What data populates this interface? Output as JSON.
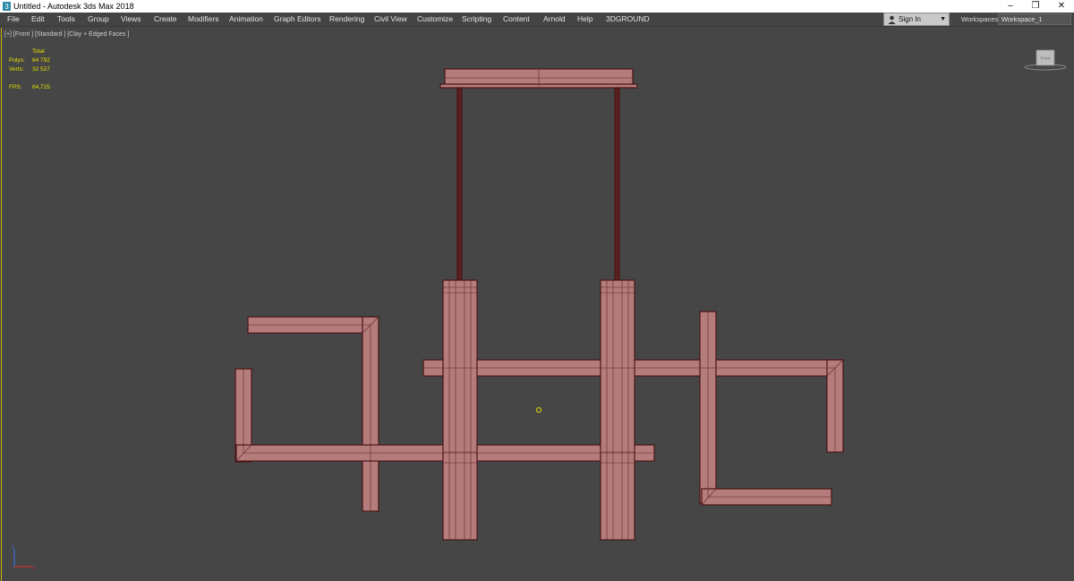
{
  "window": {
    "title": "Untitled - Autodesk 3ds Max 2018",
    "controls": {
      "minimize": "–",
      "restore": "❐",
      "close": "✕"
    }
  },
  "menubar": {
    "items": [
      "File",
      "Edit",
      "Tools",
      "Group",
      "Views",
      "Create",
      "Modifiers",
      "Animation",
      "Graph Editors",
      "Rendering",
      "Civil View",
      "Customize",
      "Scripting",
      "Content",
      "Arnold",
      "Help",
      "3DGROUND"
    ]
  },
  "account": {
    "sign_in_label": "Sign In",
    "dropdown_arrow": "▼"
  },
  "workspaces": {
    "label": "Workspaces:",
    "selected": "Workspace_1"
  },
  "viewport": {
    "label": "[+] [Front ] [Standard ] [Clay + Edged Faces ]",
    "stats": {
      "total_label": "Total",
      "polys_label": "Polys:",
      "polys_value": "64 792",
      "verts_label": "Verts:",
      "verts_value": "32 527",
      "fps_label": "FPS:",
      "fps_value": "64,725"
    },
    "viewcube_label": "Front",
    "model_color": "#b57c7c",
    "edge_color": "#4a1616"
  },
  "colors": {
    "viewport_bg": "#464646",
    "stats_text": "#e5e000",
    "viewport_border": "#c8b400"
  },
  "icons": [
    "app-icon",
    "user-icon",
    "viewcube",
    "axis-gizmo"
  ]
}
